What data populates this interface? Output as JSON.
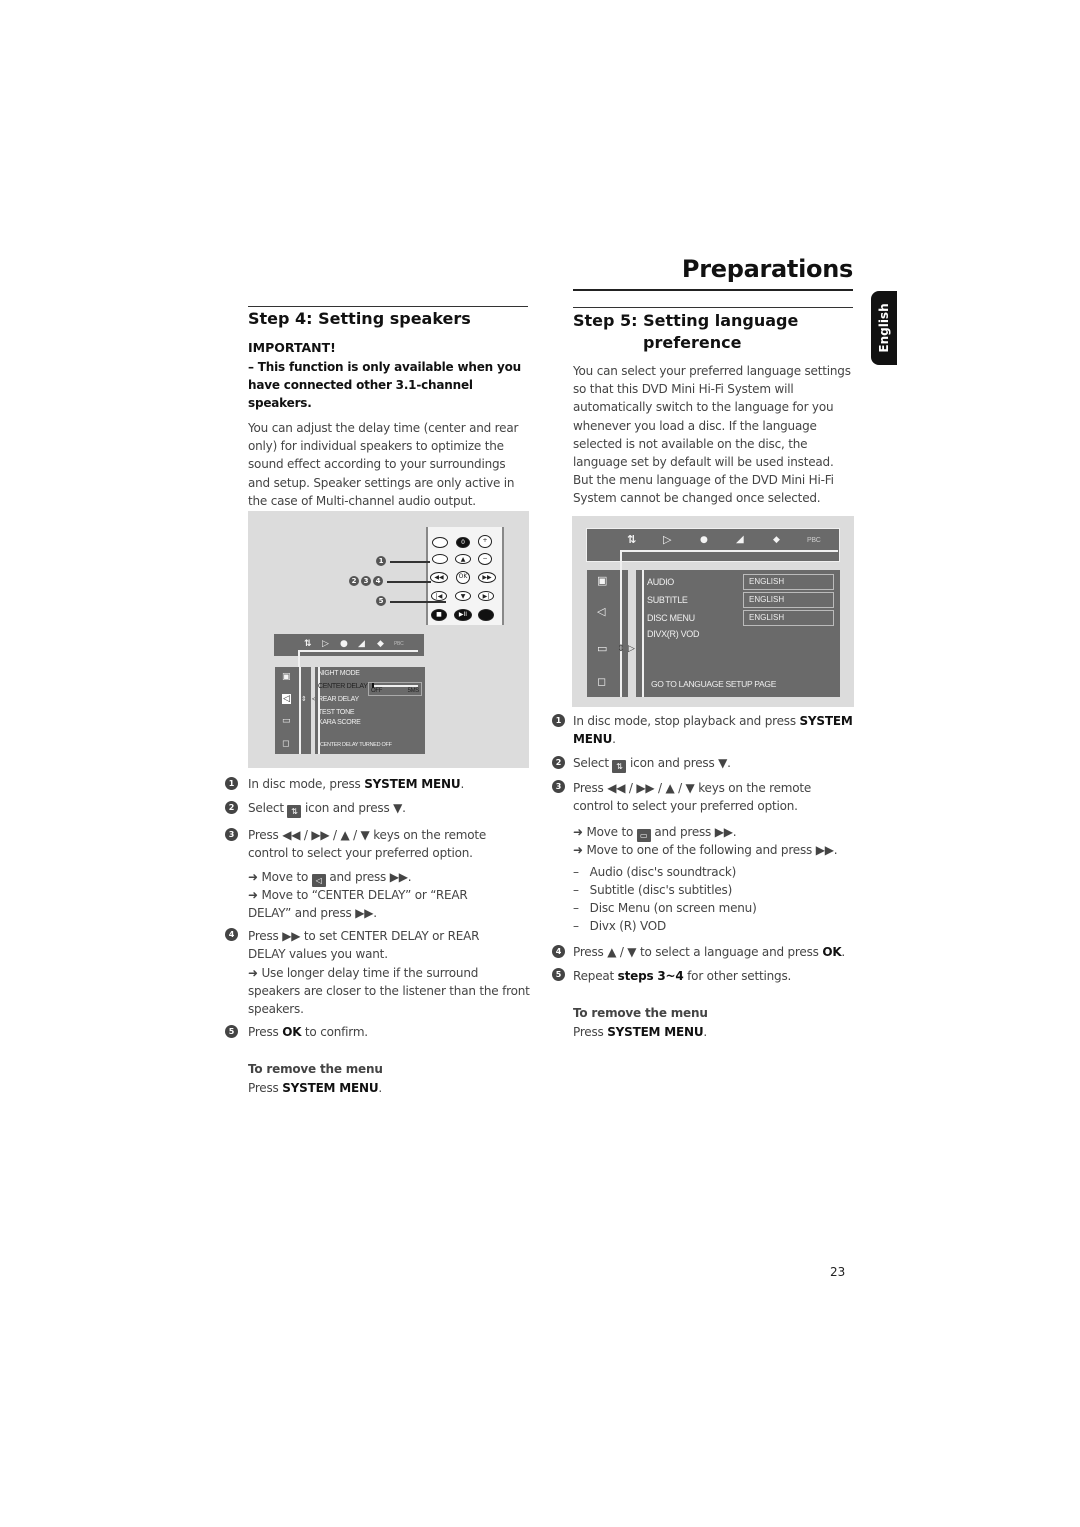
{
  "header": {
    "title": "Preparations",
    "language_tab": "English"
  },
  "left": {
    "heading": "Step 4:  Setting speakers",
    "important_label": "IMPORTANT!",
    "important_note": "–  This function is only available when you have connected other 3.1-channel speakers.",
    "intro": "You can adjust the delay time (center and rear only) for individual speakers to optimize the sound effect according to your surroundings and setup. Speaker settings are only active in the case of  Multi-channel audio output.",
    "remote_callouts": [
      "1",
      "2",
      "3",
      "4",
      "5"
    ],
    "remote_buttons": {
      "ok": "OK",
      "zero": "0",
      "plus": "+",
      "minus": "−",
      "up": "▲",
      "down": "▼",
      "prev": "◀◀",
      "next": "▶▶",
      "skip_prev": "|◀",
      "skip_next": "▶|",
      "stop": "■",
      "play_pause": "▶II"
    },
    "osd": {
      "top_icons": [
        "setup-icon",
        "play-icon",
        "zoom-icon",
        "angle-icon",
        "brightness-icon",
        "pbc-label"
      ],
      "pbc": "PBC",
      "menu_items": [
        "NIGHT MODE",
        "CENTER DELAY",
        "REAR DELAY",
        "TEST TONE",
        "KARA SCORE"
      ],
      "slider_min": "OFF",
      "slider_max": "5MS",
      "slider_value_fraction": 0.0,
      "status": "CENTER DELAY TURNED OFF"
    },
    "steps": [
      {
        "n": "1",
        "pre": "In disc mode, press ",
        "bold": "SYSTEM MENU",
        "post": "."
      },
      {
        "n": "2",
        "pre": "Select ",
        "icon": "setup-icon",
        "post": " icon and press ▼."
      },
      {
        "n": "3",
        "line1": "Press ◀◀ / ▶▶ / ▲ / ▼ keys on the remote",
        "line2": "control to select your preferred option.",
        "sub1_pre": "➜ Move to ",
        "sub1_icon": "speaker-icon",
        "sub1_post": " and press ▶▶.",
        "sub2_line1": "➜ Move to “CENTER DELAY” or “REAR",
        "sub2_line2": "DELAY” and press ▶▶."
      },
      {
        "n": "4",
        "line1": "Press ▶▶ to set CENTER DELAY or REAR",
        "line2": "DELAY values you want.",
        "sub1": "➜ Use longer delay time if the surround",
        "sub2": "speakers are closer to the listener than the front",
        "sub3": "speakers."
      },
      {
        "n": "5",
        "pre": "Press ",
        "bold": "OK",
        "post": " to confirm."
      }
    ],
    "remove_title": "To remove the menu",
    "remove_pre": "Press ",
    "remove_bold": "SYSTEM MENU",
    "remove_post": "."
  },
  "right": {
    "heading_line1": "Step 5:  Setting language",
    "heading_line2": "preference",
    "intro": "You can select your preferred language settings so that this DVD Mini Hi-Fi System will automatically switch to the language for you whenever you load a disc. If the language selected is not available on the disc, the language set by default will be used instead. But the menu language of the DVD Mini Hi-Fi System cannot be changed once selected.",
    "osd": {
      "pbc": "PBC",
      "rows": [
        {
          "label": "AUDIO",
          "value": "ENGLISH"
        },
        {
          "label": "SUBTITLE",
          "value": "ENGLISH"
        },
        {
          "label": "DISC MENU",
          "value": "ENGLISH"
        },
        {
          "label": "DIVX(R) VOD",
          "value": ""
        }
      ],
      "footer": "GO TO LANGUAGE SETUP PAGE"
    },
    "steps": [
      {
        "n": "1",
        "pre": "In disc mode, stop playback and press ",
        "bold1": "SYSTEM",
        "bold2": "MENU",
        "post": "."
      },
      {
        "n": "2",
        "pre": "Select ",
        "post": " icon and press ▼."
      },
      {
        "n": "3",
        "line1": "Press  ◀◀ / ▶▶ /  ▲  /  ▼ keys on the remote",
        "line2": "control to select your preferred option.",
        "sub1_pre": "➜ Move to ",
        "sub1_post": "  and press ▶▶.",
        "sub2": "➜ Move to one of the following and press ▶▶."
      },
      {
        "n": "4",
        "pre": "Press ▲  /  ▼ to select a language and press ",
        "bold": "OK",
        "post": "."
      },
      {
        "n": "5",
        "pre": "Repeat ",
        "bold": "steps 3~4",
        "post": " for other settings."
      }
    ],
    "options": [
      "Audio (disc's soundtrack)",
      "Subtitle (disc's subtitles)",
      "Disc Menu (on screen menu)",
      "Divx (R) VOD"
    ],
    "remove_title": "To remove the menu",
    "remove_pre": "Press ",
    "remove_bold": "SYSTEM MENU",
    "remove_post": "."
  },
  "footer": {
    "page_number": "23"
  }
}
